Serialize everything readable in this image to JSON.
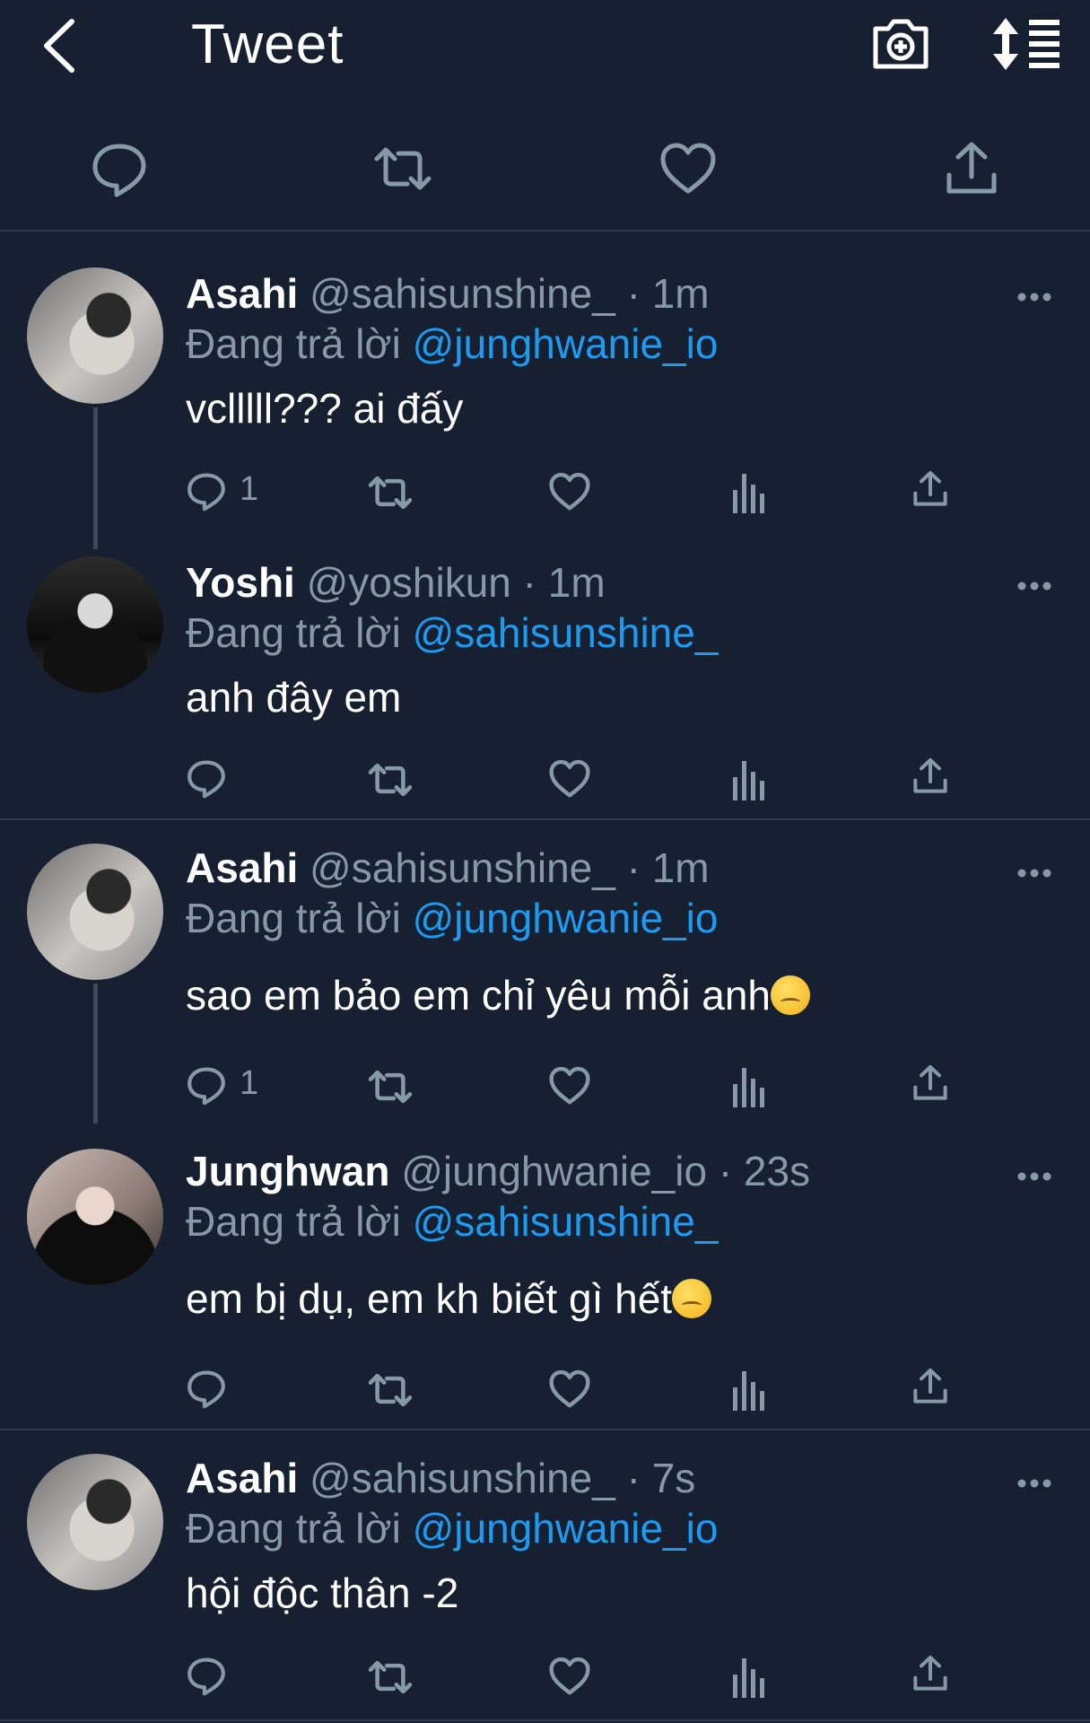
{
  "header": {
    "title": "Tweet",
    "back_icon": "chevron-left-icon",
    "camera_icon": "camera-plus-icon",
    "sort_icon": "sort-list-icon"
  },
  "main_actions": [
    "reply-icon",
    "retweet-icon",
    "like-icon",
    "share-icon"
  ],
  "tweets": [
    {
      "name": "Asahi",
      "handle": "@sahisunshine_ · 1m",
      "replying": "Đang trả lời",
      "replying_to": "@junghwanie_io",
      "text": "vclllll??? ai đấy",
      "reply_count": "1"
    },
    {
      "name": "Yoshi",
      "handle": "@yoshikun · 1m",
      "replying": "Đang trả lời",
      "replying_to": "@sahisunshine_",
      "text": "anh đây em",
      "reply_count": ""
    },
    {
      "name": "Asahi",
      "handle": "@sahisunshine_ · 1m",
      "replying": "Đang trả lời",
      "replying_to": "@junghwanie_io",
      "text": "sao em bảo em chỉ yêu mỗi anh",
      "emoji": "pensive-face-emoji",
      "reply_count": "1"
    },
    {
      "name": "Junghwan",
      "handle": "@junghwanie_io · 23s",
      "replying": "Đang trả lời",
      "replying_to": "@sahisunshine_",
      "text": "em bị dụ, em kh biết gì hết",
      "emoji": "pensive-face-emoji",
      "reply_count": ""
    },
    {
      "name": "Asahi",
      "handle": "@sahisunshine_ · 7s",
      "replying": "Đang trả lời",
      "replying_to": "@junghwanie_io",
      "text": "hội độc thân -2",
      "reply_count": ""
    }
  ],
  "colors": {
    "background": "#162030",
    "link": "#1d9bf0",
    "muted": "#8899a6"
  }
}
